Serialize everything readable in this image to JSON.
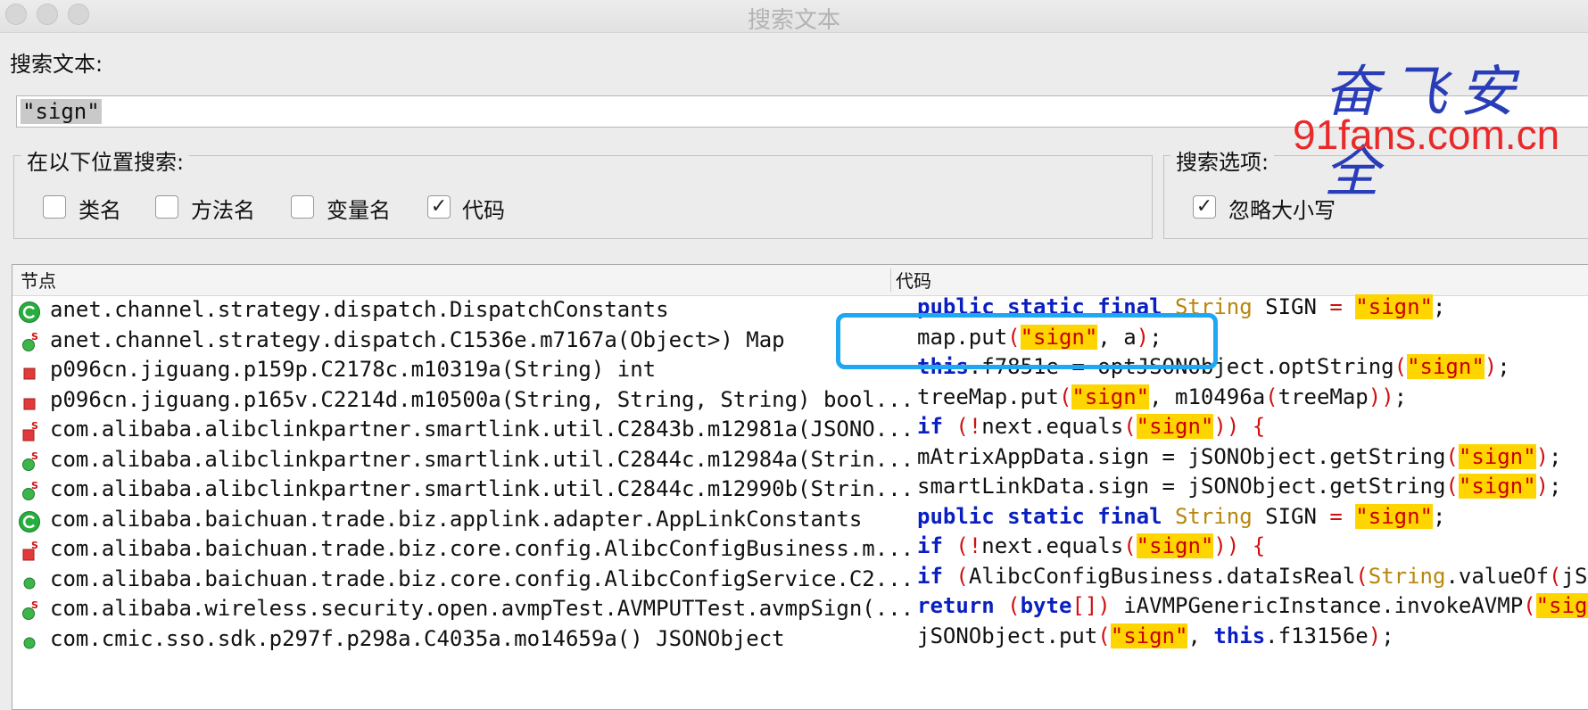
{
  "window": {
    "title": "搜索文本"
  },
  "search": {
    "label": "搜索文本:",
    "value": "\"sign\""
  },
  "scope": {
    "title": "在以下位置搜索:",
    "options": [
      {
        "label": "类名",
        "checked": false
      },
      {
        "label": "方法名",
        "checked": false
      },
      {
        "label": "变量名",
        "checked": false
      },
      {
        "label": "代码",
        "checked": true
      }
    ]
  },
  "search_options": {
    "title": "搜索选项:",
    "options": [
      {
        "label": "忽略大小写",
        "checked": true
      }
    ]
  },
  "results": {
    "columns": {
      "node": "节点",
      "code": "代码"
    },
    "rows": [
      {
        "icon": "class-icon",
        "node": "anet.channel.strategy.dispatch.DispatchConstants",
        "code": [
          [
            "kw",
            "public static final "
          ],
          [
            "type",
            "String"
          ],
          [
            "plain",
            " SIGN "
          ],
          [
            "op",
            "="
          ],
          [
            "plain",
            " "
          ],
          [
            "str",
            "\"sign\""
          ],
          [
            "plain",
            ";"
          ]
        ]
      },
      {
        "icon": "static-method-public-icon",
        "node": "anet.channel.strategy.dispatch.C1536e.m7167a(Object>) Map",
        "code": [
          [
            "plain",
            "map.put"
          ],
          [
            "paren",
            "("
          ],
          [
            "str",
            "\"sign\""
          ],
          [
            "plain",
            ", a"
          ],
          [
            "paren",
            ")"
          ],
          [
            "plain",
            ";"
          ]
        ]
      },
      {
        "icon": "private-method-icon",
        "node": "p096cn.jiguang.p159p.C2178c.m10319a(String) int",
        "code": [
          [
            "kw",
            "this"
          ],
          [
            "plain",
            ".f7851e = optJSONObject.optString"
          ],
          [
            "paren",
            "("
          ],
          [
            "str",
            "\"sign\""
          ],
          [
            "paren",
            ")"
          ],
          [
            "plain",
            ";"
          ]
        ]
      },
      {
        "icon": "private-method-icon",
        "node": "p096cn.jiguang.p165v.C2214d.m10500a(String, String, String) bool...",
        "code": [
          [
            "plain",
            "treeMap.put"
          ],
          [
            "paren",
            "("
          ],
          [
            "str",
            "\"sign\""
          ],
          [
            "plain",
            ", m10496a"
          ],
          [
            "paren",
            "("
          ],
          [
            "plain",
            "treeMap"
          ],
          [
            "paren",
            "))"
          ],
          [
            "plain",
            ";"
          ]
        ]
      },
      {
        "icon": "static-method-private-icon",
        "node": "com.alibaba.alibclinkpartner.smartlink.util.C2843b.m12981a(JSONO...",
        "code": [
          [
            "kw",
            "if"
          ],
          [
            "plain",
            " "
          ],
          [
            "paren",
            "(!"
          ],
          [
            "plain",
            "next.equals"
          ],
          [
            "paren",
            "("
          ],
          [
            "str",
            "\"sign\""
          ],
          [
            "paren",
            "))"
          ],
          [
            "plain",
            " "
          ],
          [
            "paren",
            "{"
          ]
        ]
      },
      {
        "icon": "static-method-public-icon",
        "node": "com.alibaba.alibclinkpartner.smartlink.util.C2844c.m12984a(Strin...",
        "code": [
          [
            "plain",
            "mAtrixAppData.sign = jSONObject.getString"
          ],
          [
            "paren",
            "("
          ],
          [
            "str",
            "\"sign\""
          ],
          [
            "paren",
            ")"
          ],
          [
            "plain",
            ";"
          ]
        ]
      },
      {
        "icon": "static-method-public-icon",
        "node": "com.alibaba.alibclinkpartner.smartlink.util.C2844c.m12990b(Strin...",
        "code": [
          [
            "plain",
            "smartLinkData.sign = jSONObject.getString"
          ],
          [
            "paren",
            "("
          ],
          [
            "str",
            "\"sign\""
          ],
          [
            "paren",
            ")"
          ],
          [
            "plain",
            ";"
          ]
        ]
      },
      {
        "icon": "class-icon",
        "node": "com.alibaba.baichuan.trade.biz.applink.adapter.AppLinkConstants",
        "code": [
          [
            "kw",
            "public static final "
          ],
          [
            "type",
            "String"
          ],
          [
            "plain",
            " SIGN "
          ],
          [
            "op",
            "="
          ],
          [
            "plain",
            " "
          ],
          [
            "str",
            "\"sign\""
          ],
          [
            "plain",
            ";"
          ]
        ]
      },
      {
        "icon": "static-method-private-icon",
        "node": "com.alibaba.baichuan.trade.biz.core.config.AlibcConfigBusiness.m...",
        "code": [
          [
            "kw",
            "if"
          ],
          [
            "plain",
            " "
          ],
          [
            "paren",
            "(!"
          ],
          [
            "plain",
            "next.equals"
          ],
          [
            "paren",
            "("
          ],
          [
            "str",
            "\"sign\""
          ],
          [
            "paren",
            "))"
          ],
          [
            "plain",
            " "
          ],
          [
            "paren",
            "{"
          ]
        ]
      },
      {
        "icon": "public-method-icon",
        "node": "com.alibaba.baichuan.trade.biz.core.config.AlibcConfigService.C2...",
        "code": [
          [
            "kw",
            "if"
          ],
          [
            "plain",
            " "
          ],
          [
            "paren",
            "("
          ],
          [
            "plain",
            "AlibcConfigBusiness.dataIsReal"
          ],
          [
            "paren",
            "("
          ],
          [
            "type",
            "String"
          ],
          [
            "plain",
            ".valueOf"
          ],
          [
            "paren",
            "("
          ],
          [
            "plain",
            "jSON"
          ]
        ]
      },
      {
        "icon": "static-method-public-icon",
        "node": "com.alibaba.wireless.security.open.avmpTest.AVMPUTTest.avmpSign(...",
        "code": [
          [
            "kw",
            "return"
          ],
          [
            "plain",
            " "
          ],
          [
            "paren",
            "("
          ],
          [
            "kw",
            "byte"
          ],
          [
            "paren",
            "[])"
          ],
          [
            "plain",
            " iAVMPGenericInstance.invokeAVMP"
          ],
          [
            "paren",
            "("
          ],
          [
            "str",
            "\"sign\""
          ]
        ]
      },
      {
        "icon": "public-method-icon",
        "node": "com.cmic.sso.sdk.p297f.p298a.C4035a.mo14659a() JSONObject",
        "code": [
          [
            "plain",
            "jSONObject.put"
          ],
          [
            "paren",
            "("
          ],
          [
            "str",
            "\"sign\""
          ],
          [
            "plain",
            ", "
          ],
          [
            "kw",
            "this"
          ],
          [
            "plain",
            ".f13156e"
          ],
          [
            "paren",
            ")"
          ],
          [
            "plain",
            ";"
          ]
        ]
      }
    ]
  },
  "watermark": {
    "line1": "奋飞安全",
    "line2": "91fans.com.cn"
  },
  "colors": {
    "highlight": "#ffd500",
    "keyword": "#0a1fbf",
    "string": "#c80000",
    "annotation": "#1ea7f2"
  }
}
